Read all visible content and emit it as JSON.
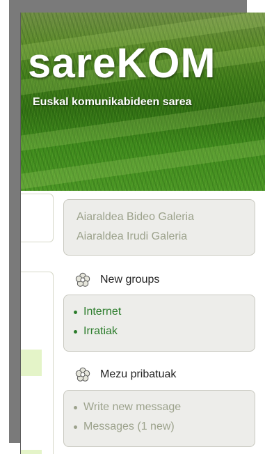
{
  "colors": {
    "active_link": "#2b7c2b",
    "muted_link": "#9ca28c",
    "box_bg": "#ededea",
    "box_border": "#c8c8bf",
    "accent_green_light": "#e4f4c8"
  },
  "header": {
    "site_title": "sareKOM",
    "tagline": "Euskal komunikabideen sarea"
  },
  "galleries": {
    "links": [
      {
        "label": "Aiaraldea Bideo Galeria"
      },
      {
        "label": "Aiaraldea Irudi Galeria"
      }
    ]
  },
  "new_groups": {
    "icon": "flower-icon",
    "heading": "New groups",
    "items": [
      {
        "label": "Internet"
      },
      {
        "label": "Irratiak"
      }
    ]
  },
  "private_messages": {
    "icon": "flower-icon",
    "heading": "Mezu pribatuak",
    "items": [
      {
        "label": "Write new message"
      },
      {
        "label": "Messages (1 new)"
      }
    ]
  }
}
